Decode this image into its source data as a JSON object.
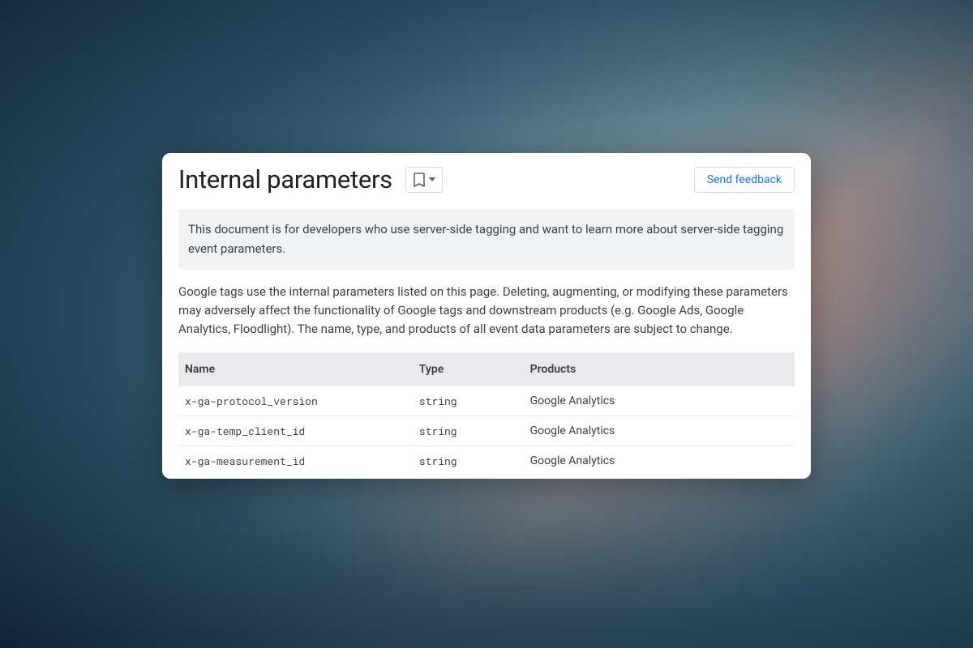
{
  "title": "Internal parameters",
  "feedback_label": "Send feedback",
  "info_text": "This document is for developers who use server-side tagging and want to learn more about server-side tagging event parameters.",
  "body_text": "Google tags use the internal parameters listed on this page. Deleting, augmenting, or modifying these parameters may adversely affect the functionality of Google tags and downstream products (e.g. Google Ads, Google Analytics, Floodlight). The name, type, and products of all event data parameters are subject to change.",
  "table": {
    "headers": {
      "name": "Name",
      "type": "Type",
      "products": "Products"
    },
    "rows": [
      {
        "name": "x-ga-protocol_version",
        "type": "string",
        "products": "Google Analytics"
      },
      {
        "name": "x-ga-temp_client_id",
        "type": "string",
        "products": "Google Analytics"
      },
      {
        "name": "x-ga-measurement_id",
        "type": "string",
        "products": "Google Analytics"
      }
    ]
  }
}
